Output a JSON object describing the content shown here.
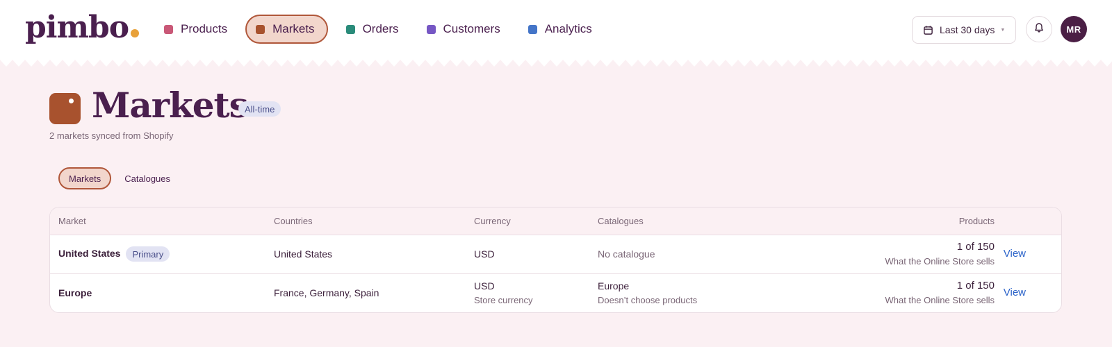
{
  "app": {
    "logo": "pimbo"
  },
  "nav": {
    "items": [
      {
        "label": "Products",
        "color": "#c95877"
      },
      {
        "label": "Markets",
        "color": "#a8522e",
        "active": true
      },
      {
        "label": "Orders",
        "color": "#2a8b7a"
      },
      {
        "label": "Customers",
        "color": "#7657c4"
      },
      {
        "label": "Analytics",
        "color": "#4475c8"
      }
    ],
    "date_range": "Last 30 days",
    "user_initials": "MR"
  },
  "page": {
    "title": "Markets",
    "badge": "All-time",
    "subtitle": "2 markets synced from Shopify",
    "accent": "#a8522e"
  },
  "tabs": [
    {
      "label": "Markets",
      "active": true
    },
    {
      "label": "Catalogues",
      "active": false
    }
  ],
  "table": {
    "headers": {
      "market": "Market",
      "countries": "Countries",
      "currency": "Currency",
      "catalogues": "Catalogues",
      "products": "Products"
    },
    "rows": [
      {
        "market": "United States",
        "badge": "Primary",
        "countries": "United States",
        "currency": "USD",
        "currency_note": "",
        "catalogue": "No catalogue",
        "catalogue_note": "",
        "products": "1 of 150",
        "products_note": "What the Online Store sells",
        "action": "View"
      },
      {
        "market": "Europe",
        "badge": "",
        "countries": "France, Germany, Spain",
        "currency": "USD",
        "currency_note": "Store currency",
        "catalogue": "Europe",
        "catalogue_note": "Doesn’t choose products",
        "products": "1 of 150",
        "products_note": "What the Online Store sells",
        "action": "View"
      }
    ]
  }
}
